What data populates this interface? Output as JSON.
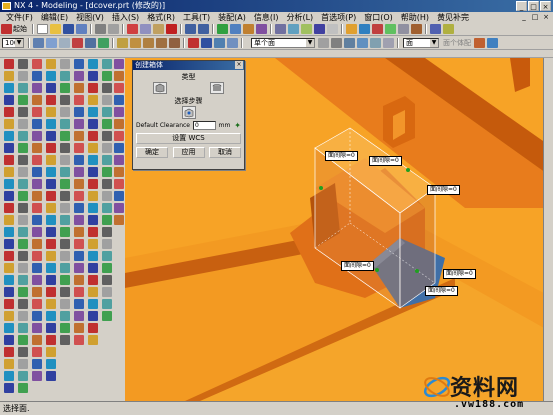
{
  "window": {
    "title": "NX 4 - Modeling - [dcover.prt (修改的)]",
    "minimize": "_",
    "maximize": "□",
    "close": "×"
  },
  "menu": [
    "文件(F)",
    "编辑(E)",
    "视图(V)",
    "插入(S)",
    "格式(R)",
    "工具(T)",
    "装配(A)",
    "信息(I)",
    "分析(L)",
    "首选项(P)",
    "窗口(O)",
    "帮助(H)",
    "黄见补完"
  ],
  "toolbar": {
    "start_label": "起始",
    "zoom_value": "100",
    "selection_filter": "单个面",
    "filter_combo": "面",
    "filter_hint": "面个体配"
  },
  "dialog": {
    "title": "创建箱体",
    "type_label": "类型",
    "steps_label": "选择步骤",
    "clearance_label": "Default Clearance",
    "clearance_value": "0",
    "clearance_unit": "mm",
    "wcs_button": "设置 WCS",
    "ok_button": "确定",
    "apply_button": "应用",
    "cancel_button": "取消"
  },
  "callouts": [
    "面间隙=0",
    "面间隙=0",
    "面间隙=0",
    "面间隙=0",
    "面间隙=0",
    "面间隙=0"
  ],
  "status": {
    "prompt": "选择面."
  },
  "watermark": {
    "logo_text": "资料网",
    "url": ".vw188.com"
  },
  "colors": {
    "background": "#f7a326",
    "part_top": "#e8761a",
    "part_side": "#c85a0c",
    "box_blue": "#3f6fa7"
  }
}
